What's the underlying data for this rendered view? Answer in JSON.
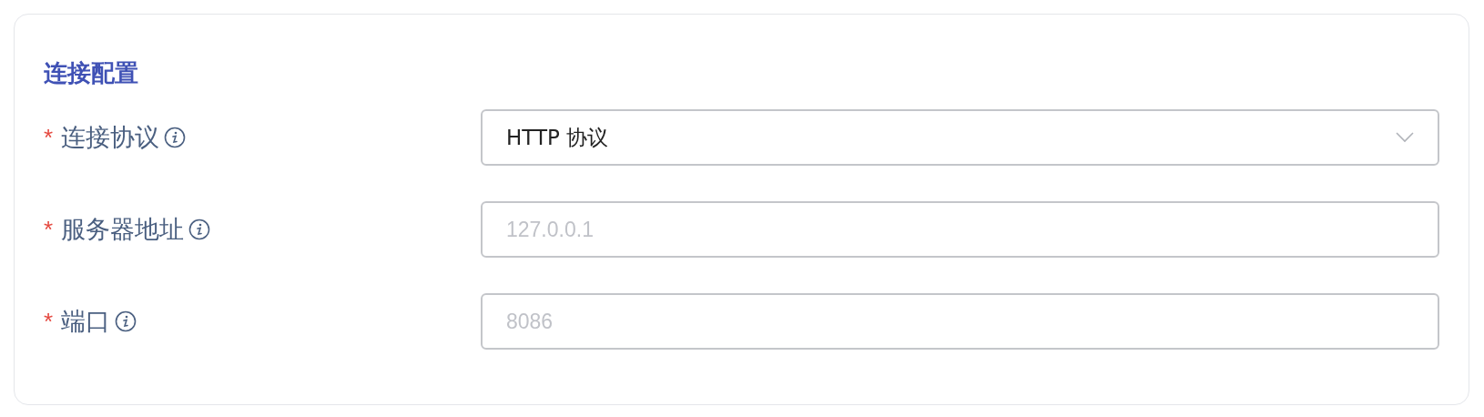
{
  "section": {
    "title": "连接配置"
  },
  "fields": [
    {
      "marker": "*",
      "label": "连接协议",
      "kind": "select",
      "value": "HTTP 协议"
    },
    {
      "marker": "*",
      "label": "服务器地址",
      "kind": "input",
      "placeholder": "127.0.0.1"
    },
    {
      "marker": "*",
      "label": "端口",
      "kind": "input",
      "placeholder": "8086"
    }
  ]
}
